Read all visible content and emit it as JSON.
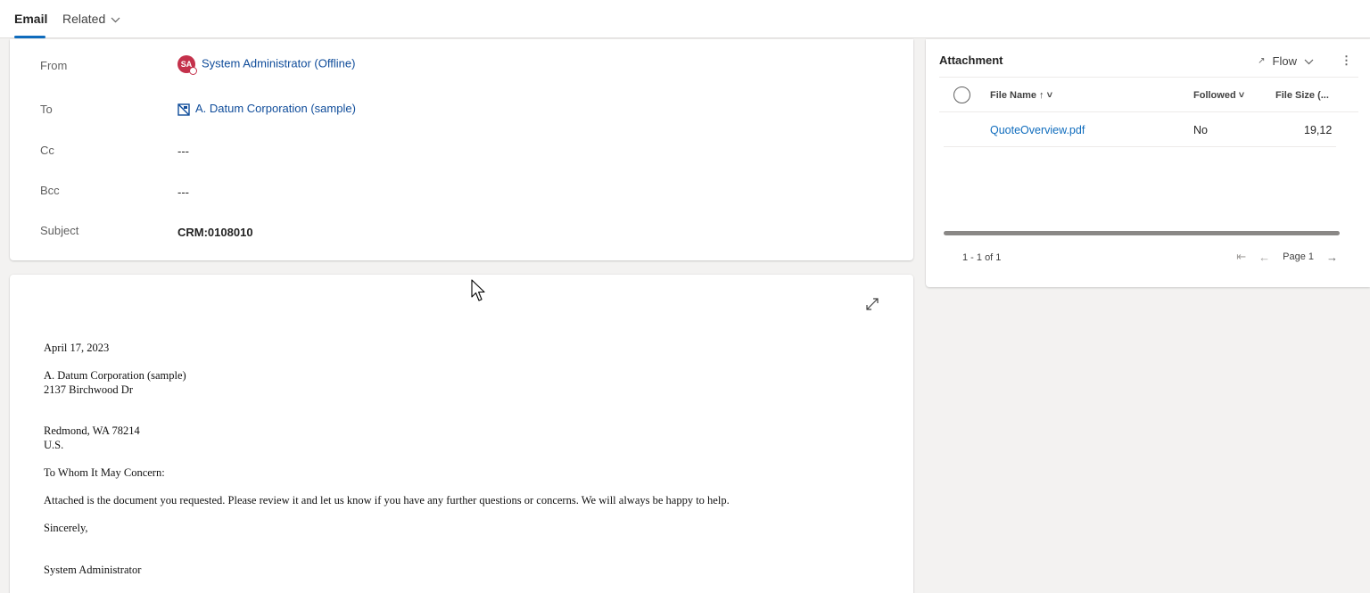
{
  "tabs": {
    "email": "Email",
    "related": "Related",
    "related_chevron": "⌵"
  },
  "header": {
    "from_label": "From",
    "from_avatar": "SA",
    "from_value": "System Administrator (Offline)",
    "to_label": "To",
    "to_value": "A. Datum Corporation (sample)",
    "cc_label": "Cc",
    "cc_value": "---",
    "bcc_label": "Bcc",
    "bcc_value": "---",
    "subject_label": "Subject",
    "subject_value": "CRM:0108010"
  },
  "body": {
    "date": "April 17, 2023",
    "address_line1": "A. Datum Corporation (sample)",
    "address_line2": "2137 Birchwood Dr",
    "address_line3": "Redmond, WA 78214",
    "address_line4": "U.S.",
    "greeting": "To Whom It May Concern:",
    "paragraph": "Attached is the document you requested.  Please review it and let us know if you have any further questions or concerns.  We will always be happy to help.",
    "closing": "Sincerely,",
    "signature": "System Administrator"
  },
  "attachment": {
    "title": "Attachment",
    "flow_label": "Flow",
    "columns": {
      "file_name": "File Name ↑ ˅",
      "followed": "Followed ˅",
      "file_size": "File Size (..."
    },
    "rows": [
      {
        "file_name": "QuoteOverview.pdf",
        "followed": "No",
        "file_size": "19,12"
      }
    ],
    "count": "1 - 1 of 1",
    "page": "Page 1"
  },
  "colors": {
    "accent": "#0f6cbd",
    "link": "#0f4c9a",
    "avatar": "#c4314b"
  }
}
